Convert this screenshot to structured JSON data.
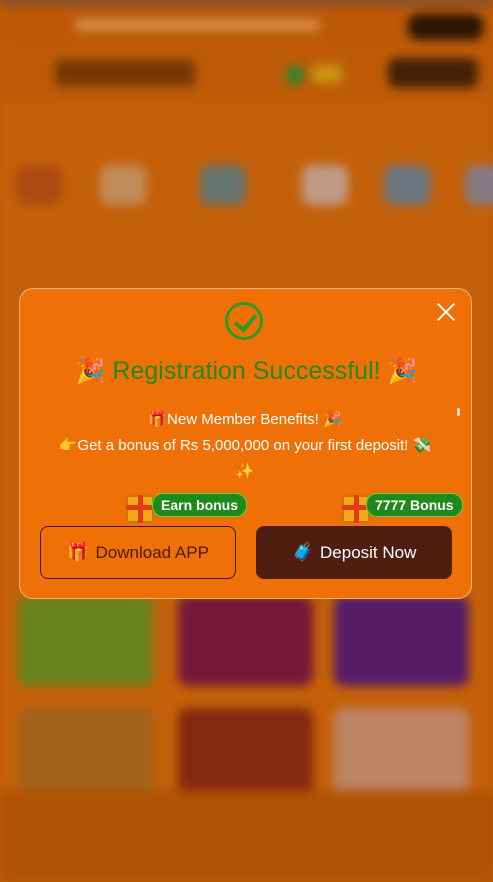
{
  "modal": {
    "title": "Registration Successful!",
    "title_emoji_left": "🎉",
    "title_emoji_right": "🎉",
    "benefit_line1": "🎁New Member Benefits! 🎉",
    "benefit_line2": "👉Get a bonus of Rs 5,000,000 on your first deposit! 💸",
    "benefit_line3": "✨",
    "earn_bonus_label": "Earn bonus",
    "bonus_amount_label": "7777 Bonus",
    "download_button_label": "Download APP",
    "download_button_icon": "🎁",
    "deposit_button_label": "Deposit Now",
    "deposit_button_icon": "🧳"
  },
  "colors": {
    "modal_bg": "#f07008",
    "success_green": "#2f9a1f",
    "deposit_button_bg": "#4f1e10"
  }
}
